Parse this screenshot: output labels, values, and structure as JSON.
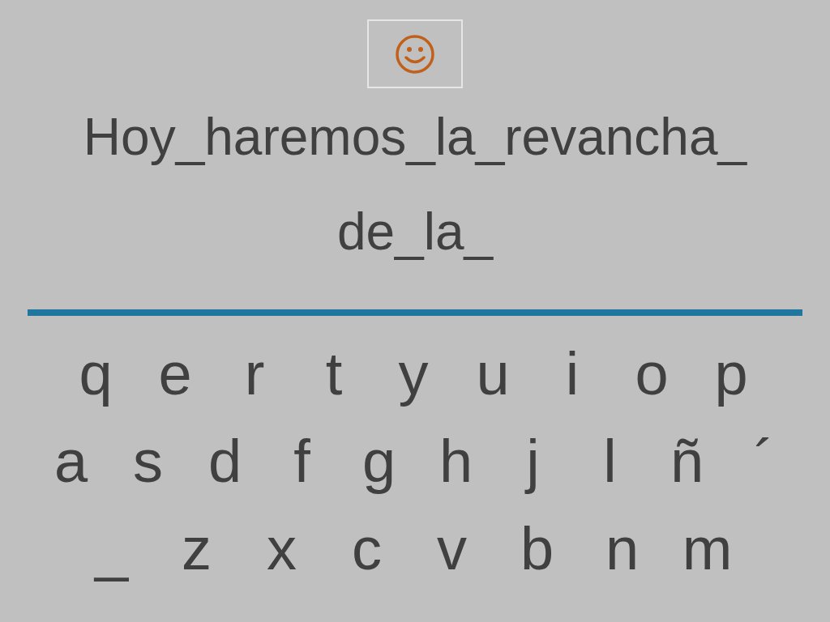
{
  "phrase_lines": [
    "Hoy_haremos_la_revancha_",
    "de_la_"
  ],
  "keyboard": [
    [
      "q",
      "e",
      "r",
      "t",
      "y",
      "u",
      "i",
      "o",
      "p"
    ],
    [
      "a",
      "s",
      "d",
      "f",
      "g",
      "h",
      "j",
      "l",
      "ñ",
      "´"
    ],
    [
      "_",
      "z",
      "x",
      "c",
      "v",
      "b",
      "n",
      "m"
    ]
  ]
}
